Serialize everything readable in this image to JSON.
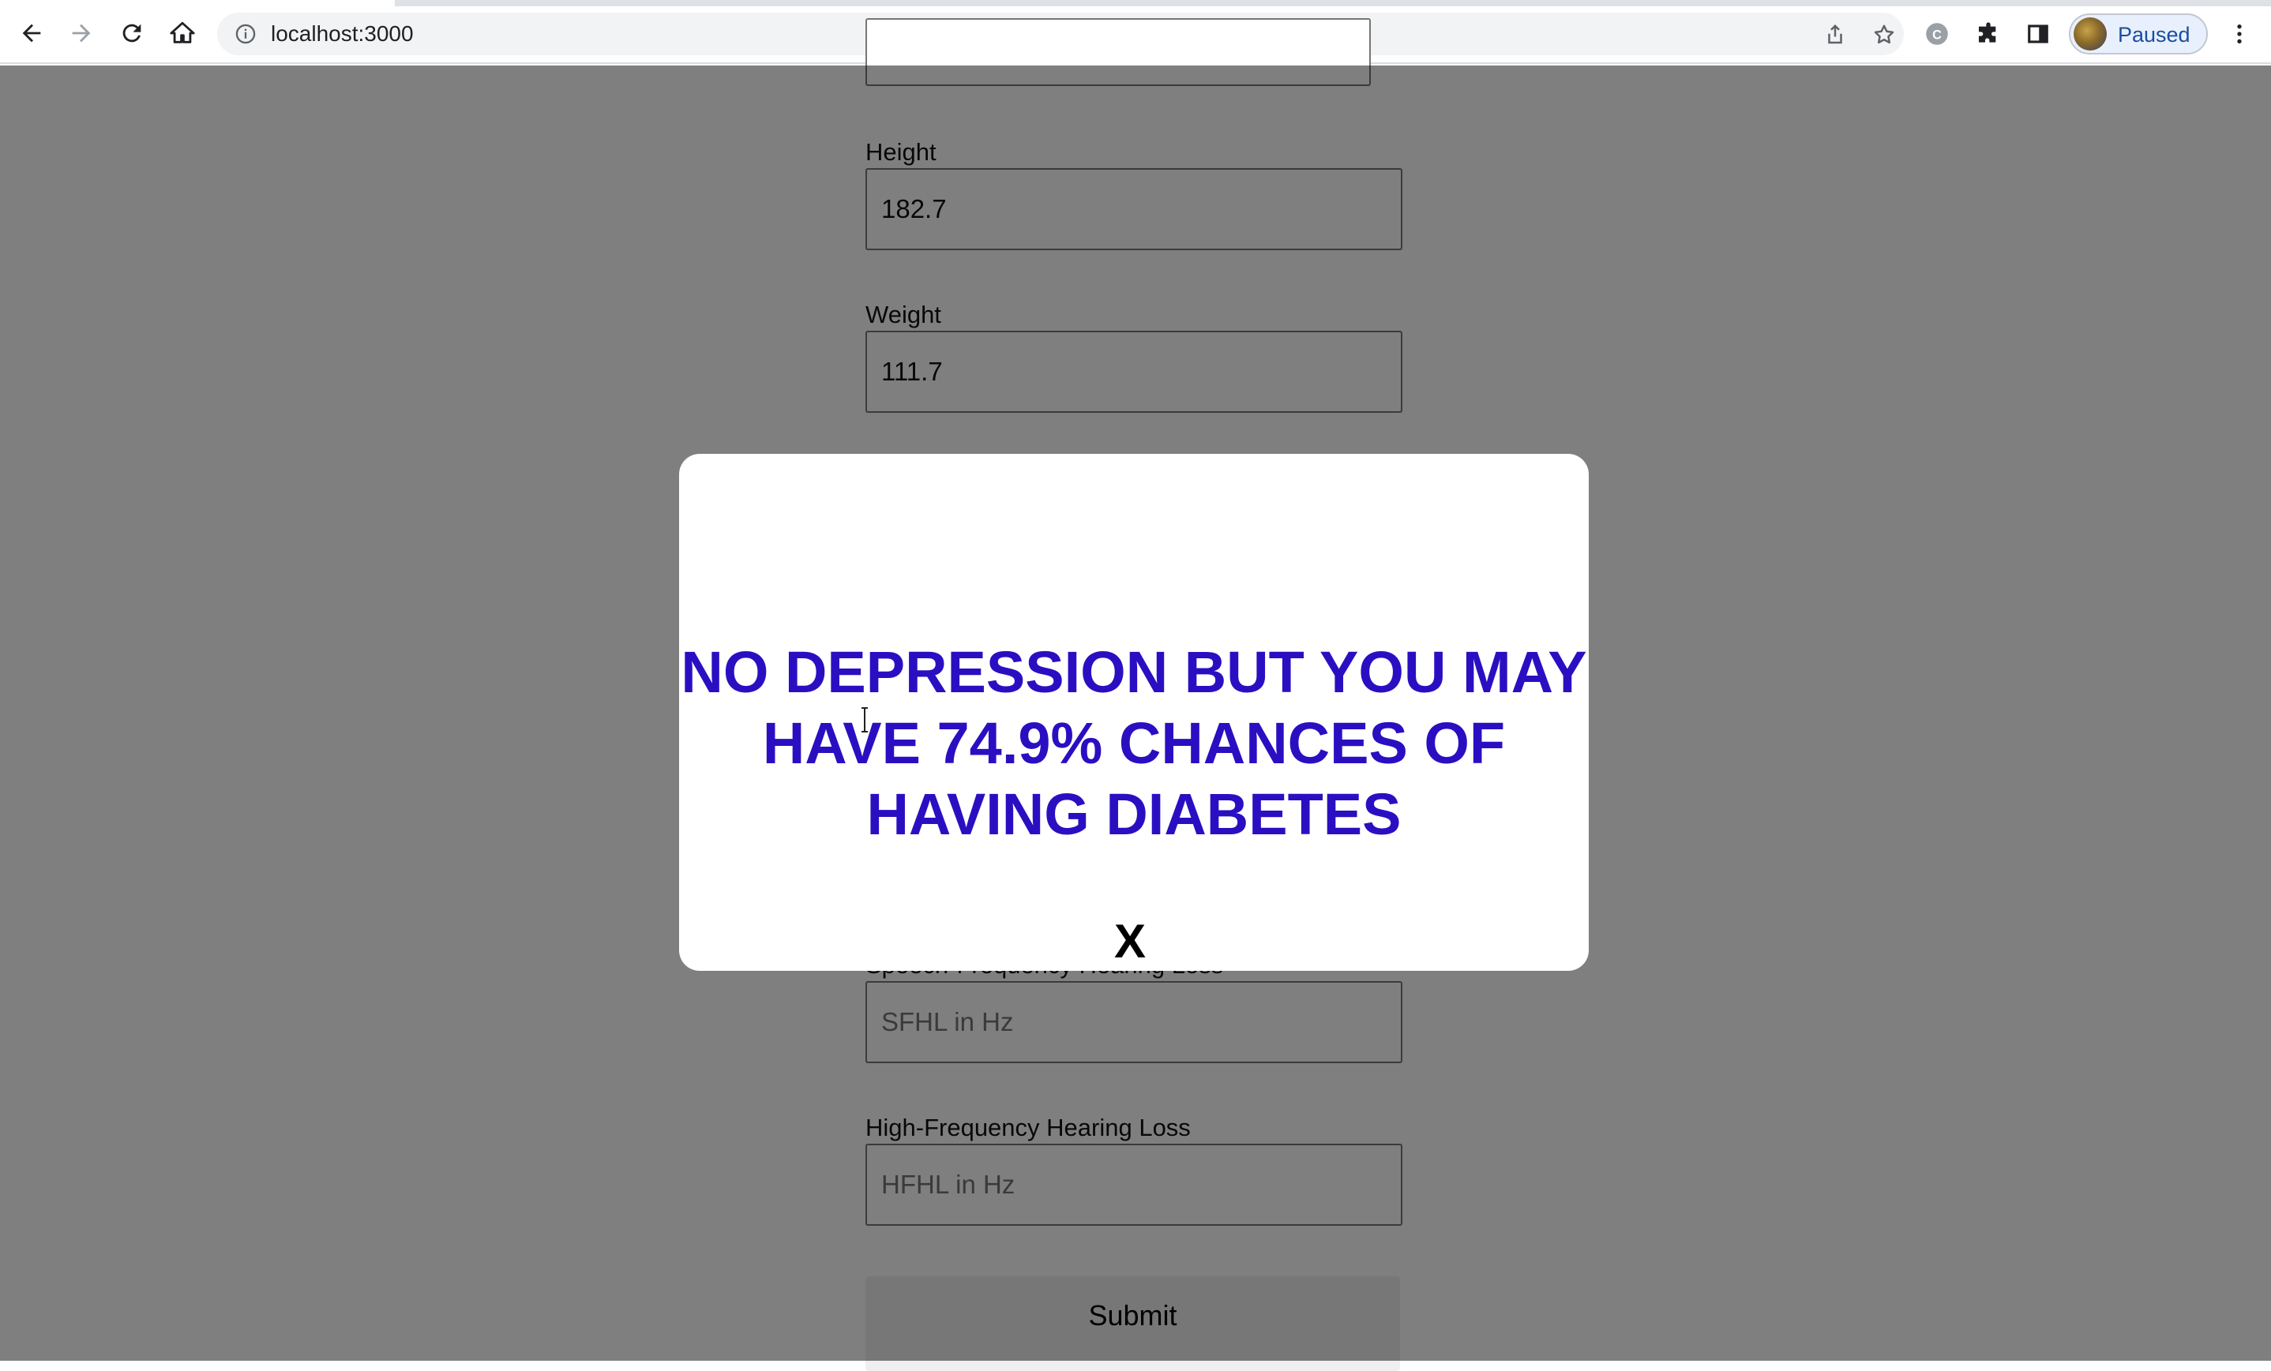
{
  "browser": {
    "url": "localhost:3000",
    "profile_label": "Paused",
    "icons": {
      "back": "arrow-left-icon",
      "forward": "arrow-right-icon",
      "reload": "reload-icon",
      "home": "home-icon",
      "site_info": "info-icon",
      "share": "share-icon",
      "bookmark": "star-icon",
      "extension_c": "c-extension-icon",
      "extensions": "puzzle-icon",
      "side_panel": "side-panel-icon",
      "menu": "kebab-menu-icon"
    }
  },
  "form": {
    "fields": [
      {
        "label": "Height",
        "value": "182.7",
        "placeholder": ""
      },
      {
        "label": "Weight",
        "value": "111.7",
        "placeholder": ""
      },
      {
        "label": "Speech-Frequency Hearing Loss",
        "value": "",
        "placeholder": "SFHL in Hz"
      },
      {
        "label": "High-Frequency Hearing Loss",
        "value": "",
        "placeholder": "HFHL in Hz"
      }
    ],
    "submit_label": "Submit"
  },
  "modal": {
    "message": "NO DEPRESSION BUT YOU MAY HAVE 74.9% CHANCES OF HAVING DIABETES",
    "close_label": "X"
  },
  "colors": {
    "modal_text": "#2a0fc2",
    "overlay": "rgba(0,0,0,0.5)"
  }
}
